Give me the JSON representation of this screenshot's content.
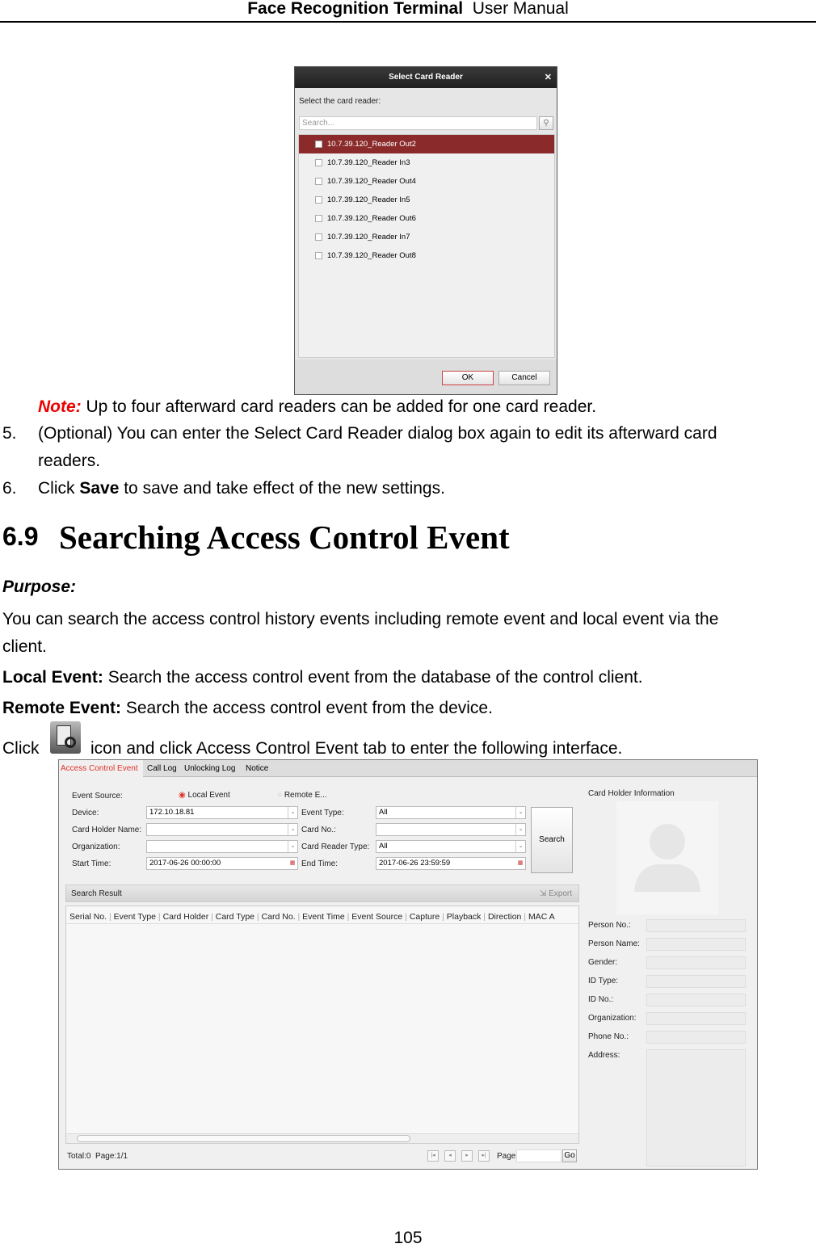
{
  "header": {
    "product": "Face Recognition Terminal",
    "doc": "User Manual"
  },
  "dialog": {
    "title": "Select Card Reader",
    "prompt": "Select the card reader:",
    "search_placeholder": "Search...",
    "readers": [
      "10.7.39.120_Reader Out2",
      "10.7.39.120_Reader In3",
      "10.7.39.120_Reader Out4",
      "10.7.39.120_Reader In5",
      "10.7.39.120_Reader Out6",
      "10.7.39.120_Reader In7",
      "10.7.39.120_Reader Out8"
    ],
    "ok": "OK",
    "cancel": "Cancel",
    "highlight_color": "#8b2a2a"
  },
  "body": {
    "note_label": "Note:",
    "note_text": " Up to four afterward card readers can be added for one card reader.",
    "step5_num": "5.",
    "step5_line1": "(Optional) You can enter the Select Card Reader dialog box again to edit its afterward card",
    "step5_line2": "readers.",
    "step6_num": "6.",
    "step6_pre": "Click ",
    "step6_bold": "Save",
    "step6_post": " to save and take effect of the new settings.",
    "section_num": "6.9",
    "section_title": "Searching Access Control Event",
    "purpose": "Purpose:",
    "purpose_line1": "You can search the access control history events including remote event and local event via the",
    "purpose_line2": "client.",
    "local_label": "Local Event:",
    "local_text": " Search the access control event from the database of the control client.",
    "remote_label": "Remote Event:",
    "remote_text": " Search the access control event from the device.",
    "click_pre": "Click",
    "click_post": "icon and click Access Control Event tab to enter the following interface.",
    "page_number": "105"
  },
  "app": {
    "tabs": [
      "Access Control Event",
      "Call Log",
      "Unlocking Log",
      "Notice"
    ],
    "event_source_label": "Event Source:",
    "local_event": "Local Event",
    "remote_event": "Remote E...",
    "device_label": "Device:",
    "device_value": "172.10.18.81",
    "event_type_label": "Event Type:",
    "event_type_value": "All",
    "card_holder_label": "Card Holder Name:",
    "card_no_label": "Card No.:",
    "organization_label": "Organization:",
    "card_reader_type_label": "Card Reader Type:",
    "card_reader_type_value": "All",
    "start_label": "Start Time:",
    "start_value": "2017-06-26 00:00:00",
    "end_label": "End Time:",
    "end_value": "2017-06-26 23:59:59",
    "search": "Search",
    "result_title": "Search Result",
    "export": "Export",
    "columns": [
      "Serial No.",
      "Event Type",
      "Card Holder",
      "Card Type",
      "Card No.",
      "Event Time",
      "Event Source",
      "Capture",
      "Playback",
      "Direction",
      "MAC A"
    ],
    "total": "Total:0",
    "page_info": "Page:1/1",
    "page_label": "Page",
    "go": "Go",
    "info_title": "Card Holder Information",
    "info_fields": [
      "Person No.:",
      "Person Name:",
      "Gender:",
      "ID Type:",
      "ID No.:",
      "Organization:",
      "Phone No.:",
      "Address:"
    ],
    "accent": "#e0312b"
  }
}
